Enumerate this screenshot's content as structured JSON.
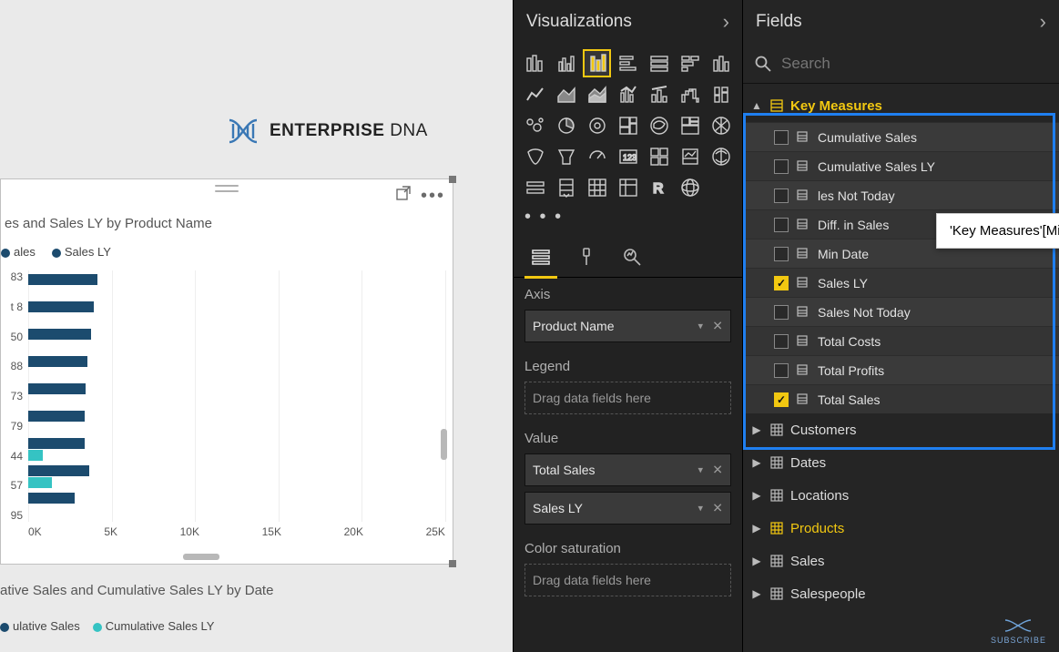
{
  "logo": {
    "strong": "ENTERPRISE",
    "light": " DNA"
  },
  "chart": {
    "title": "es and Sales LY by Product Name",
    "legend": {
      "series1": "ales",
      "series2": "Sales LY"
    }
  },
  "chart_data": {
    "type": "bar",
    "orientation": "horizontal",
    "title": "es and Sales LY by Product Name",
    "xlabel": "",
    "ylabel": "",
    "xlim": [
      0,
      26000
    ],
    "x_ticks": [
      "0K",
      "5K",
      "10K",
      "15K",
      "20K",
      "25K"
    ],
    "y_tick_labels": [
      "83",
      "t 8",
      "50",
      "88",
      "73",
      "79",
      "44",
      "57",
      "95"
    ],
    "series": [
      {
        "name": "ales",
        "values": [
          4300,
          4100,
          3900,
          3700,
          3600,
          3500,
          3500,
          3800,
          2900
        ]
      },
      {
        "name": "Sales LY",
        "values": [
          0,
          0,
          0,
          0,
          0,
          0,
          900,
          1500,
          0
        ]
      }
    ],
    "legend_position": "top-left",
    "grid": true
  },
  "sub_chart": {
    "title": "ative Sales and Cumulative Sales LY by Date",
    "legend": {
      "a": "ulative Sales",
      "b": "Cumulative Sales LY"
    }
  },
  "viz": {
    "header": "Visualizations",
    "ellipsis": "• • •",
    "sections": {
      "axis": {
        "label": "Axis",
        "value": "Product Name"
      },
      "legend": {
        "label": "Legend",
        "placeholder": "Drag data fields here"
      },
      "value": {
        "label": "Value",
        "items": [
          "Total Sales",
          "Sales LY"
        ]
      },
      "colorsat": {
        "label": "Color saturation",
        "placeholder": "Drag data fields here"
      }
    }
  },
  "fields": {
    "header": "Fields",
    "search_placeholder": "Search",
    "tooltip": "'Key Measures'[Min Date]",
    "key_measures": {
      "name": "Key Measures",
      "items": [
        {
          "name": "Cumulative Sales",
          "checked": false
        },
        {
          "name": "Cumulative Sales LY",
          "checked": false
        },
        {
          "name": "les Not Today",
          "checked": false,
          "partial": true
        },
        {
          "name": "Diff. in Sales",
          "checked": false
        },
        {
          "name": "Min Date",
          "checked": false
        },
        {
          "name": "Sales LY",
          "checked": true
        },
        {
          "name": "Sales Not Today",
          "checked": false
        },
        {
          "name": "Total Costs",
          "checked": false
        },
        {
          "name": "Total Profits",
          "checked": false
        },
        {
          "name": "Total Sales",
          "checked": true
        }
      ]
    },
    "tables": [
      "Customers",
      "Dates",
      "Locations",
      "Products",
      "Sales",
      "Salespeople"
    ],
    "selected_table": "Products"
  },
  "subscribe": "SUBSCRIBE"
}
